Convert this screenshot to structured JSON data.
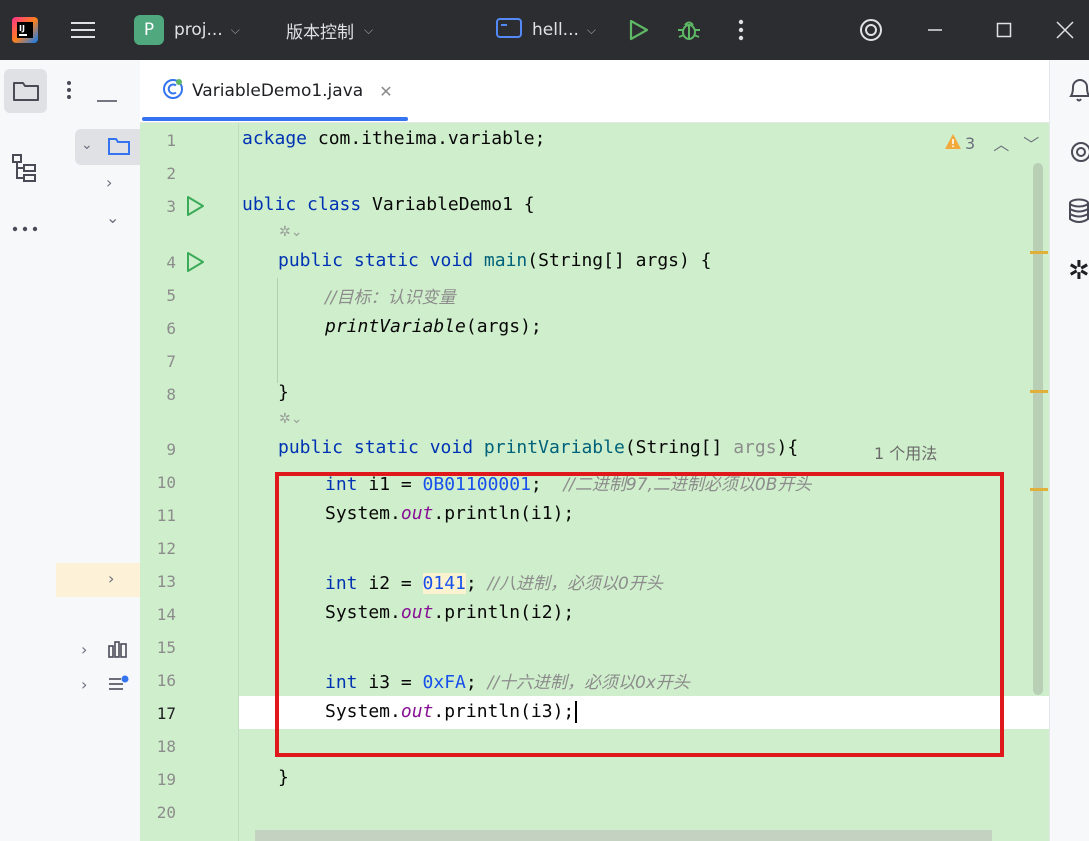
{
  "titlebar": {
    "project_label": "proj...",
    "project_badge": "P",
    "vcs_label": "版本控制",
    "run_config_label": "hell..."
  },
  "tab": {
    "filename": "VariableDemo1.java"
  },
  "editor": {
    "line_numbers": [
      "1",
      "2",
      "3",
      "4",
      "5",
      "6",
      "7",
      "8",
      "9",
      "10",
      "11",
      "12",
      "13",
      "14",
      "15",
      "16",
      "17",
      "18",
      "19",
      "20"
    ],
    "warnings_count": "3",
    "usage_hint": "1 个用法",
    "lines": {
      "l1_kw": "ackage",
      "l1_rest": " com.itheima.variable;",
      "l3_kw1": "ublic",
      "l3_kw2": "class",
      "l3_rest": " VariableDemo1 {",
      "l4_kw": "public static void",
      "l4_mth": "main",
      "l4_rest": "(String[] args) {",
      "l5_cmt": "//目标：认识变量",
      "l6_call": "printVariable",
      "l6_rest": "(args);",
      "l8": "}",
      "l9_kw": "public static void",
      "l9_mth": "printVariable",
      "l9_rest": "(String[] ",
      "l9_param": "args",
      "l9_end": "){",
      "l10_kw": "int",
      "l10_mid": " i1 = ",
      "l10_num": "0B01100001",
      "l10_semi": ";  ",
      "l10_cmt": "//二进制97,二进制必须以0B开头",
      "l11_a": "System.",
      "l11_fld": "out",
      "l11_b": ".println(i1);",
      "l13_kw": "int",
      "l13_mid": " i2 = ",
      "l13_num": "0141",
      "l13_semi": "; ",
      "l13_cmt": "//八进制，必须以0开头",
      "l14_a": "System.",
      "l14_fld": "out",
      "l14_b": ".println(i2);",
      "l16_kw": "int",
      "l16_mid": " i3 = ",
      "l16_num": "0xFA",
      "l16_semi": "; ",
      "l16_cmt": "//十六进制，必须以0x开头",
      "l17_a": "System.",
      "l17_fld": "out",
      "l17_b": ".println(i3);",
      "l19": "}"
    }
  },
  "colors": {
    "accent": "#3574f0",
    "highlight_box": "#e0181c",
    "editor_bg": "#cfeecb",
    "run_green": "#3bab5a"
  },
  "icons": [
    "app-logo-icon",
    "hamburger-menu-icon",
    "chevron-down-icon",
    "run-config-icon",
    "run-icon",
    "debug-icon",
    "more-vert-icon",
    "ai-assistant-icon",
    "minimize-icon",
    "maximize-icon",
    "close-icon",
    "folder-icon",
    "structure-icon",
    "more-horiz-icon",
    "java-class-icon",
    "tab-close-icon",
    "warning-icon",
    "notifications-icon",
    "database-icon"
  ]
}
